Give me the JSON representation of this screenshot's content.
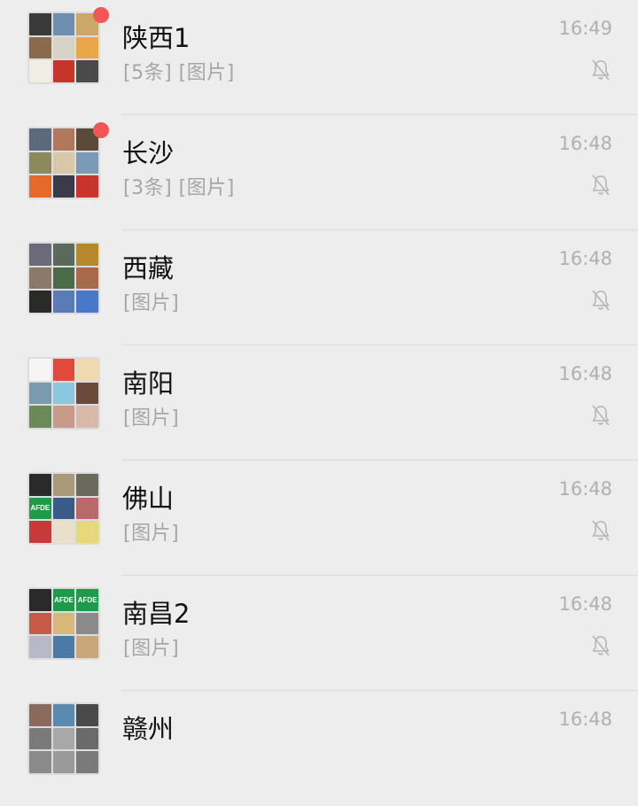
{
  "chats": [
    {
      "name": "陕西1",
      "preview": "[5条] [图片]",
      "time": "16:49",
      "unread": true,
      "muted": true,
      "avatar": [
        "#3a3a3a",
        "#6e8fb2",
        "#c9a86a",
        "#8a6a4c",
        "#d6d2c8",
        "#e8a84a",
        "#f0ede4",
        "#c6342a",
        "#4a4a4a"
      ]
    },
    {
      "name": "长沙",
      "preview": "[3条] [图片]",
      "time": "16:48",
      "unread": true,
      "muted": true,
      "avatar": [
        "#5a6a7a",
        "#b07a5a",
        "#5a4a3a",
        "#8a8a5a",
        "#d8c8a8",
        "#7a9ab8",
        "#e36a2a",
        "#3a3a4a",
        "#c8342a"
      ]
    },
    {
      "name": "西藏",
      "preview": "[图片]",
      "time": "16:48",
      "unread": false,
      "muted": true,
      "avatar": [
        "#6a6a7a",
        "#5a6a5a",
        "#b8882a",
        "#8a7a6a",
        "#4a6a4a",
        "#a86a4a",
        "#2a2a2a",
        "#5a7ab8",
        "#4a78c8"
      ]
    },
    {
      "name": "南阳",
      "preview": "[图片]",
      "time": "16:48",
      "unread": false,
      "muted": true,
      "avatar": [
        "#f5f5f5",
        "#e04a3a",
        "#f0d8b0",
        "#7a9ab0",
        "#8ac8e0",
        "#6a4a3a",
        "#6a8a5a",
        "#c89a8a",
        "#d8b8a8"
      ]
    },
    {
      "name": "佛山",
      "preview": "[图片]",
      "time": "16:48",
      "unread": false,
      "muted": true,
      "avatar": [
        "#2a2a2a",
        "#a89a7a",
        "#6a6a5a",
        "#1f9a4a",
        "#3a5a8a",
        "#b86a6a",
        "#c83a3a",
        "#e8e0c8",
        "#e8d87a"
      ],
      "avatar_tag": "AFDE"
    },
    {
      "name": "南昌2",
      "preview": "[图片]",
      "time": "16:48",
      "unread": false,
      "muted": true,
      "avatar": [
        "#2a2a2a",
        "#1f9a4a",
        "#1f9a4a",
        "#c85a4a",
        "#d8b87a",
        "#8a8a8a",
        "#b8b8c8",
        "#4a7aa8",
        "#c8a87a"
      ],
      "avatar_tag": "AFDE"
    },
    {
      "name": "赣州",
      "preview": "",
      "time": "16:48",
      "unread": false,
      "muted": true,
      "avatar": [
        "#8a6a5a",
        "#5a8ab0",
        "#4a4a4a",
        "#7a7a7a",
        "#a8a8a8",
        "#6a6a6a",
        "#8a8a8a",
        "#9a9a9a",
        "#7a7a7a"
      ]
    }
  ],
  "icons": {
    "mute": "bell-slash-icon",
    "unread": "unread-dot"
  }
}
